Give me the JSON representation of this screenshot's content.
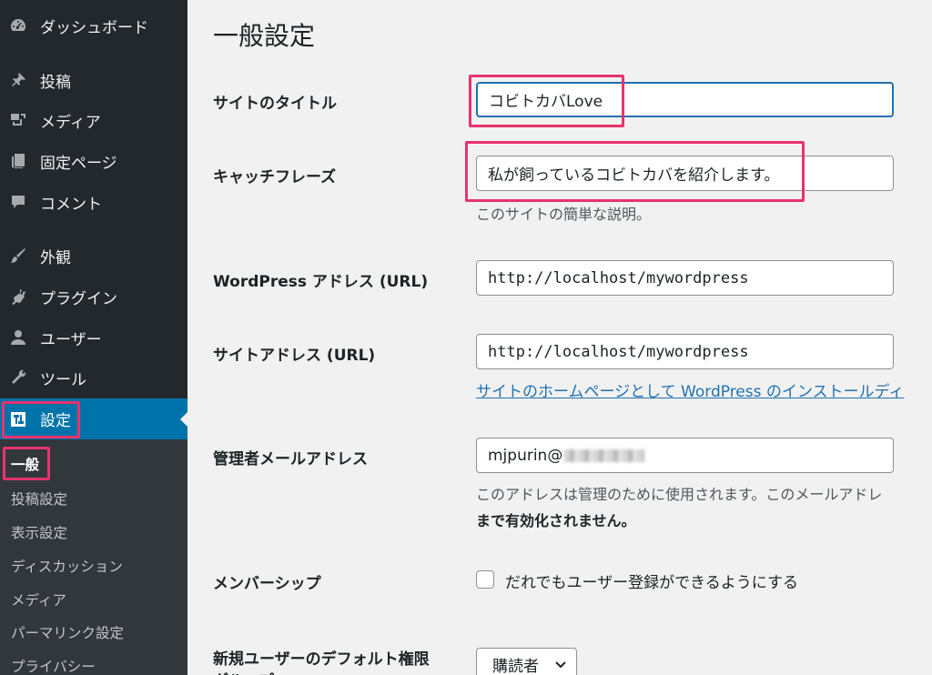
{
  "sidebar": {
    "items": [
      {
        "label": "ダッシュボード",
        "icon": "dashboard-icon"
      },
      {
        "label": "投稿",
        "icon": "pin-icon"
      },
      {
        "label": "メディア",
        "icon": "media-icon"
      },
      {
        "label": "固定ページ",
        "icon": "page-icon"
      },
      {
        "label": "コメント",
        "icon": "comment-icon"
      },
      {
        "label": "外観",
        "icon": "brush-icon"
      },
      {
        "label": "プラグイン",
        "icon": "plugin-icon"
      },
      {
        "label": "ユーザー",
        "icon": "user-icon"
      },
      {
        "label": "ツール",
        "icon": "wrench-icon"
      },
      {
        "label": "設定",
        "icon": "settings-icon"
      }
    ],
    "submenu": [
      "一般",
      "投稿設定",
      "表示設定",
      "ディスカッション",
      "メディア",
      "パーマリンク設定",
      "プライバシー"
    ]
  },
  "main": {
    "title": "一般設定",
    "site_title": {
      "label": "サイトのタイトル",
      "value": "コビトカバLove"
    },
    "tagline": {
      "label": "キャッチフレーズ",
      "value": "私が飼っているコビトカバを紹介します。",
      "description": "このサイトの簡単な説明。"
    },
    "wp_address": {
      "label": "WordPress アドレス (URL)",
      "value": "http://localhost/mywordpress"
    },
    "site_address": {
      "label": "サイトアドレス (URL)",
      "value": "http://localhost/mywordpress",
      "link": "サイトのホームページとして WordPress のインストールディ"
    },
    "admin_email": {
      "label": "管理者メールアドレス",
      "value": "mjpurin@",
      "description_line1": "このアドレスは管理のために使用されます。このメールアドレ",
      "description_line2": "まで有効化されません。"
    },
    "membership": {
      "label": "メンバーシップ",
      "checkbox_label": "だれでもユーザー登録ができるようにする"
    },
    "default_role": {
      "label": "新規ユーザーのデフォルト権限",
      "label_line2": "グループ",
      "selected": "購読者"
    }
  },
  "colors": {
    "accent": "#0073aa",
    "highlight": "#e8336e",
    "sidebar_bg": "#23282d",
    "link": "#2271b1"
  }
}
